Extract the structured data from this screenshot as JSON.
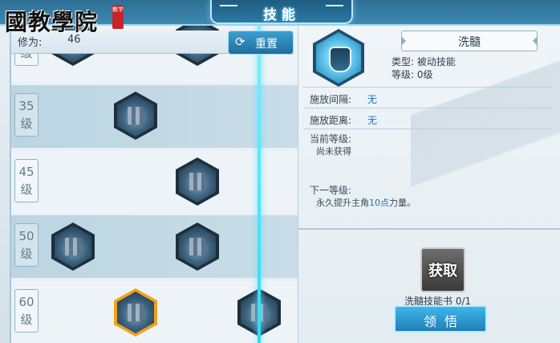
{
  "header": {
    "title": "技能"
  },
  "watermark": {
    "logo_text": "國教學院",
    "seal_text": "教学"
  },
  "cultivation": {
    "label": "修为:",
    "value": "46"
  },
  "reset_button": {
    "label": "重置",
    "icon": "refresh-icon"
  },
  "levels": [
    {
      "num": "35",
      "unit": "级"
    },
    {
      "num": "45",
      "unit": "级"
    },
    {
      "num": "50",
      "unit": "级"
    },
    {
      "num": "60",
      "unit": "级"
    }
  ],
  "partial_level": {
    "num": "",
    "unit": "级"
  },
  "skill": {
    "name": "洗髓",
    "type_line": "类型:  被动技能",
    "level_line": "等级:  0级",
    "cast_interval": {
      "label": "施放间隔:",
      "value": "无"
    },
    "cast_range": {
      "label": "施放距离:",
      "value": "无"
    },
    "current_level": {
      "label": "当前等级:",
      "desc": "尚未获得"
    },
    "next_level": {
      "label": "下一等级:",
      "desc_before": "永久提升主角",
      "desc_accent": "10点",
      "desc_after": "力量。"
    }
  },
  "acquire_button": {
    "label": "获取"
  },
  "skill_book": {
    "text": "洗髓技能书 0/1"
  },
  "comprehend_button": {
    "label": "领悟"
  },
  "colors": {
    "accent": "#1e73c8",
    "selected_frame": "#f0a21c",
    "guide_line": "#4fe3ff"
  }
}
